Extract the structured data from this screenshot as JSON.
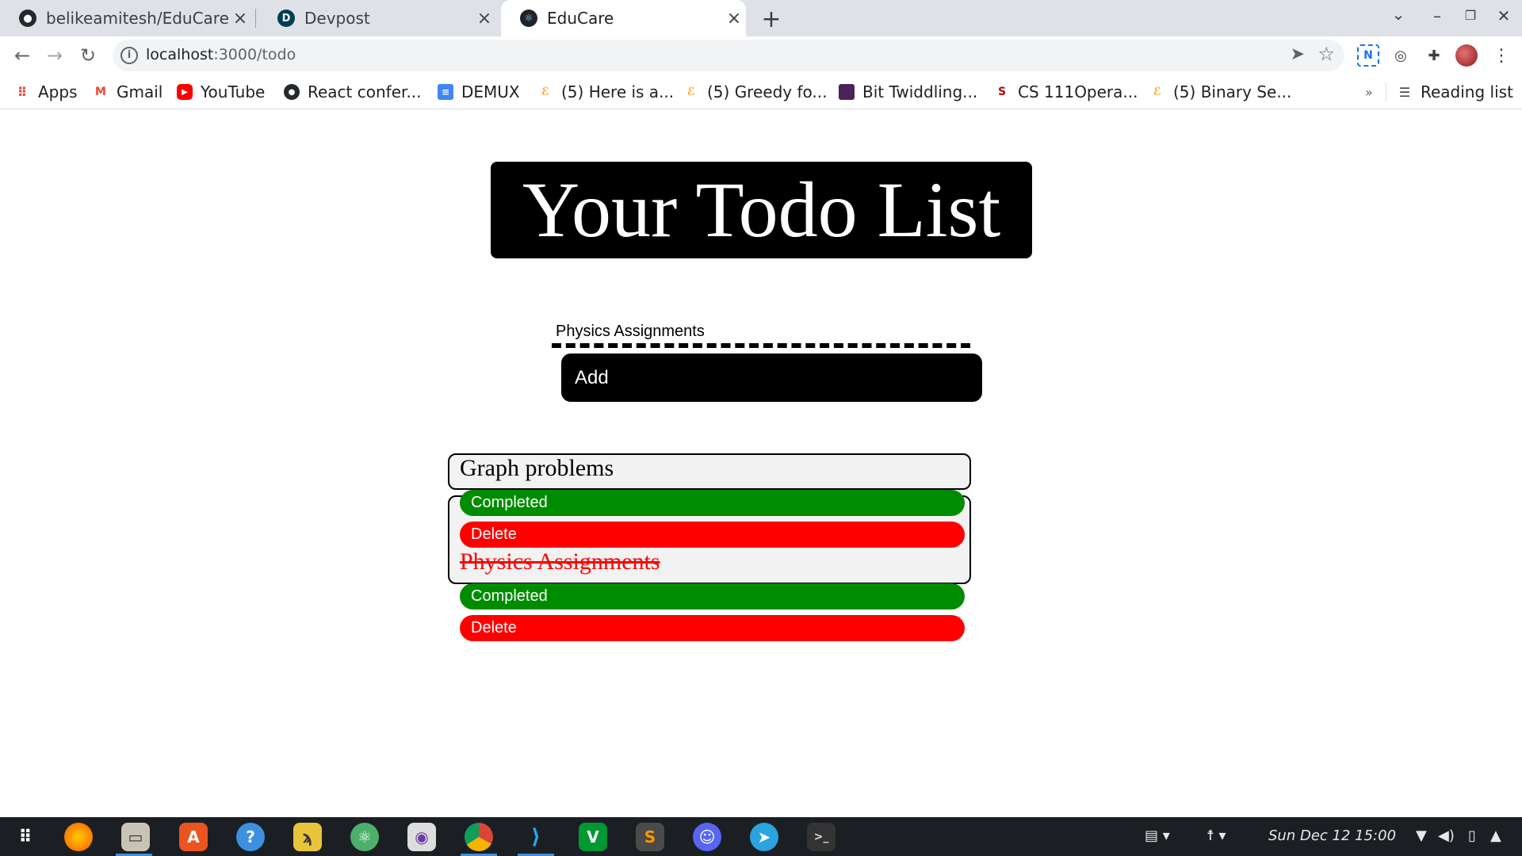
{
  "browser": {
    "tabs": [
      {
        "title": "belikeamitesh/EduCare",
        "icon": "github-icon",
        "active": false
      },
      {
        "title": "Devpost",
        "icon": "devpost-icon",
        "active": false
      },
      {
        "title": "EduCare",
        "icon": "react-icon",
        "active": true
      }
    ],
    "new_tab": "+",
    "url_host": "localhost",
    "url_path": ":3000/todo",
    "bookmarks": [
      {
        "label": "Apps",
        "icon": "apps-grid-icon"
      },
      {
        "label": "Gmail",
        "icon": "gmail-icon"
      },
      {
        "label": "YouTube",
        "icon": "youtube-icon"
      },
      {
        "label": "React confer...",
        "icon": "github-icon"
      },
      {
        "label": "DEMUX",
        "icon": "docs-icon"
      },
      {
        "label": "(5) Here is a...",
        "icon": "leetcode-icon"
      },
      {
        "label": "(5) Greedy fo...",
        "icon": "leetcode-icon"
      },
      {
        "label": "Bit Twiddling...",
        "icon": "bookmark-square-icon"
      },
      {
        "label": "CS 111Opera...",
        "icon": "stanford-icon"
      },
      {
        "label": "(5) Binary Se...",
        "icon": "leetcode-icon"
      }
    ],
    "bookmarks_overflow": "»",
    "reading_list": "Reading list"
  },
  "page": {
    "title": "Your Todo List",
    "input_value": "Physics Assignments",
    "add_label": "Add",
    "todos": [
      {
        "text": "Graph problems",
        "completed": false,
        "complete_label": "Completed",
        "delete_label": "Delete"
      },
      {
        "text": "Physics Assignments",
        "completed": true,
        "complete_label": "Completed",
        "delete_label": "Delete"
      }
    ]
  },
  "taskbar": {
    "apps": [
      "app-grid-icon",
      "firefox-icon",
      "files-icon",
      "software-center-icon",
      "help-icon",
      "pokemon-icon",
      "atom-icon",
      "camera-icon",
      "chrome-icon",
      "vscode-icon",
      "vim-icon",
      "sublime-icon",
      "discord-icon",
      "telegram-icon",
      "terminal-icon"
    ],
    "clock": "Sun Dec 12  15:00"
  },
  "colors": {
    "completed_button": "#008c00",
    "delete_button": "#ff0000",
    "done_text": "#ff0000",
    "title_bg": "#000000"
  }
}
